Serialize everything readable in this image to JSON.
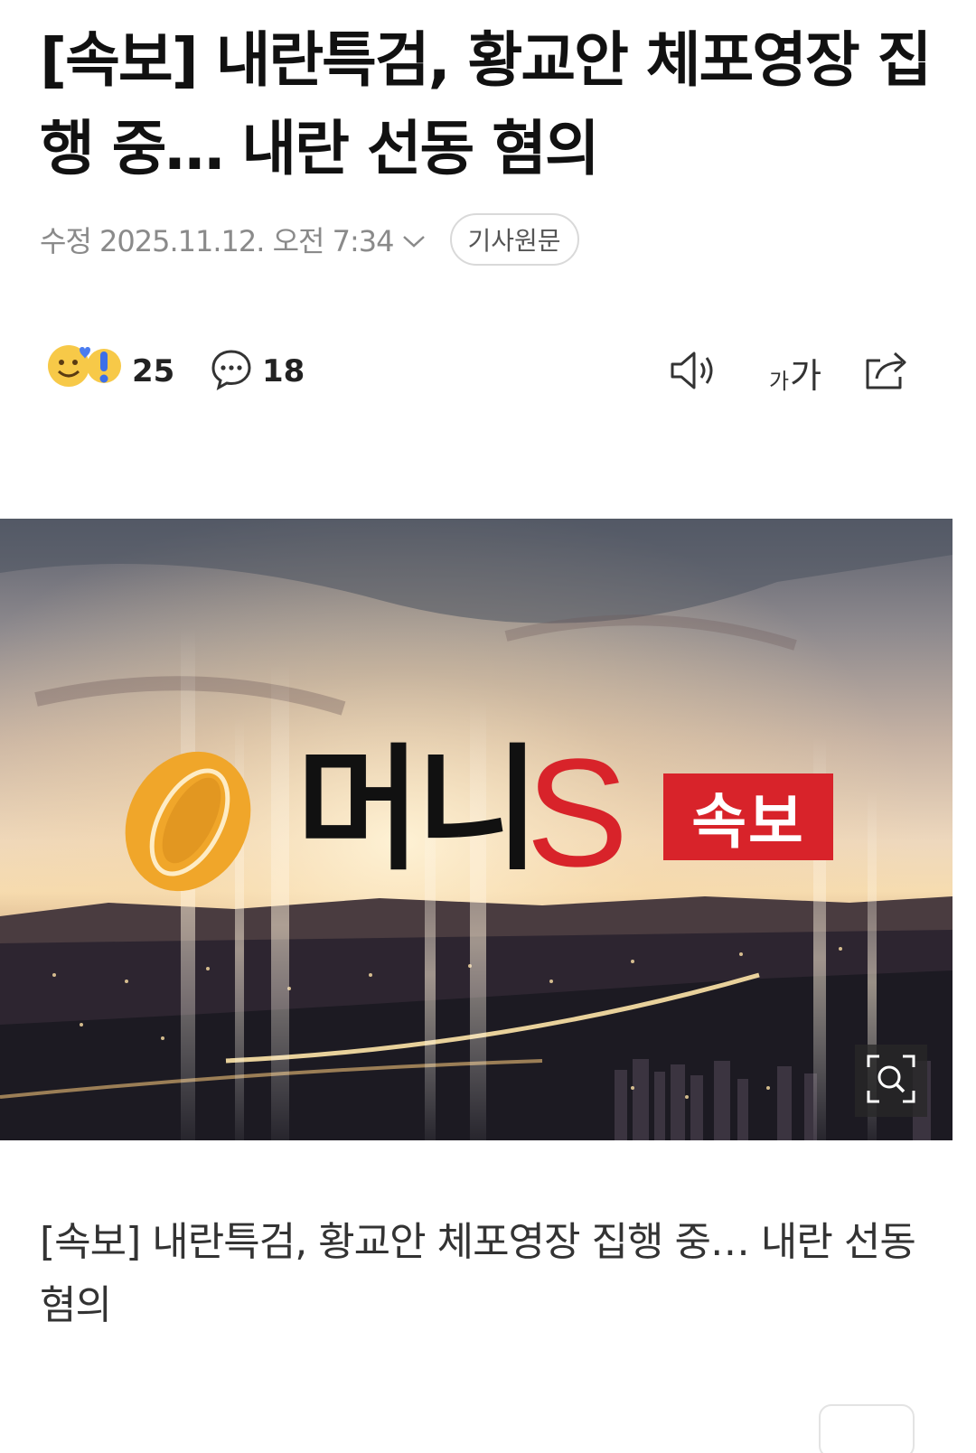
{
  "article": {
    "headline": "[속보] 내란특검, 황교안 체포영장 집행 중… 내란 선동 혐의",
    "date": "수정 2025.11.12. 오전 7:34",
    "source_button": "기사원문"
  },
  "actions": {
    "reaction_count": "25",
    "comment_count": "18",
    "font_small": "가",
    "font_large": "가"
  },
  "image": {
    "brand_name": "머니",
    "brand_letter": "S",
    "badge": "속보"
  },
  "caption": "[속보] 내란특검, 황교안 체포영장 집행 중… 내란 선동 혐의",
  "colors": {
    "brand_red": "#d8232a",
    "logo_gold": "#f0a62a",
    "muted_text": "#8a8a8a"
  }
}
